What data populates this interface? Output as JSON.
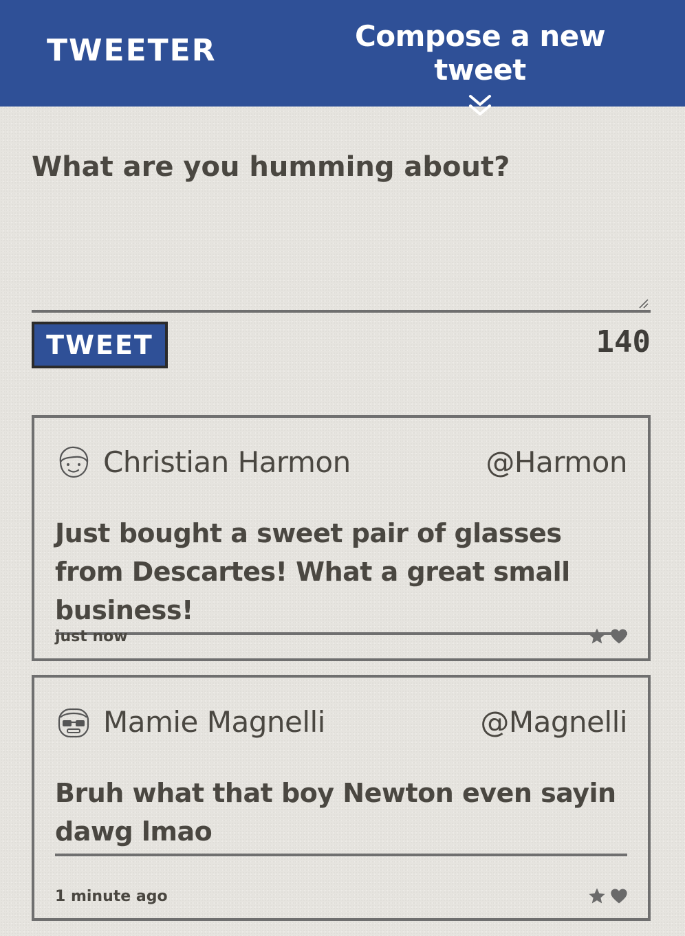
{
  "nav": {
    "brand": "TWEETER",
    "compose_label": "Compose a new tweet",
    "compose_icon": "double-chevron-down-icon"
  },
  "composer": {
    "placeholder": "What are you humming about?",
    "submit_label": "TWEET",
    "char_counter": "140"
  },
  "colors": {
    "brand_blue": "#2f5097",
    "text": "#4a4741",
    "border": "#6f6f6f",
    "background": "#e6e4df"
  },
  "tweets": [
    {
      "avatar_icon": "face-avatar-icon",
      "name": "Christian Harmon",
      "handle": "@Harmon",
      "text": "Just bought a sweet pair of glasses from Descartes! What a great small business!",
      "time": "just now",
      "actions": [
        "star-icon",
        "heart-icon"
      ]
    },
    {
      "avatar_icon": "face-with-glasses-avatar-icon",
      "name": "Mamie Magnelli",
      "handle": "@Magnelli",
      "text": "Bruh what that boy Newton even sayin dawg lmao",
      "time": "1 minute ago",
      "actions": [
        "star-icon",
        "heart-icon"
      ]
    }
  ]
}
